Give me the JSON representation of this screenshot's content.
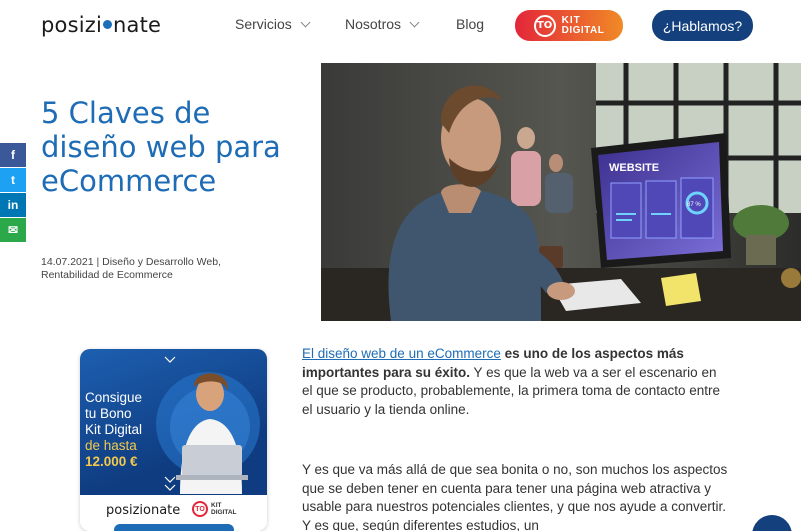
{
  "header": {
    "logo_pre": "posizi",
    "logo_post": "nate",
    "nav": [
      {
        "label": "Servicios"
      },
      {
        "label": "Nosotros"
      },
      {
        "label": "Blog"
      }
    ],
    "kit_mark": "TO",
    "kit_line1": "KIT",
    "kit_line2": "DIGITAL",
    "cta_label": "¿Hablamos?"
  },
  "share": {
    "facebook": "f",
    "twitter": "t",
    "linkedin": "in",
    "email": "✉"
  },
  "article": {
    "title": "5 Claves de diseño web para eCommerce",
    "meta": "14.07.2021 | Diseño y Desarrollo Web, Rentabilidad de Ecommerce",
    "p1_link": "El diseño web de un eCommerce",
    "p1_bold": " es uno de los aspectos más importantes para su éxito.",
    "p1_rest": " Y es que la web va a ser el escenario en el que se producto, probablemente, la primera toma de contacto entre el usuario y la tienda online.",
    "p2": "Y es que va más allá de que sea bonita o no, son muchos los aspectos que se deben tener en cuenta para tener una página web atractiva y usable para nuestros potenciales clientes, y que nos ayude a convertir. Y es que, según diferentes estudios, un"
  },
  "hero": {
    "screen_label": "WEBSITE",
    "gauge_value": "87 %"
  },
  "promo": {
    "line1": "Consigue",
    "line2": "tu Bono",
    "line3": "Kit Digital",
    "line4": "de hasta",
    "line5": "12.000 €",
    "logo": "posizionate",
    "kit_mark": "TO",
    "kit_line1": "KIT",
    "kit_line2": "DIGITAL"
  },
  "colors": {
    "brand_blue": "#1d6cb5",
    "navy": "#14407e",
    "kit_red": "#e3263a",
    "kit_orange": "#f08a26"
  }
}
